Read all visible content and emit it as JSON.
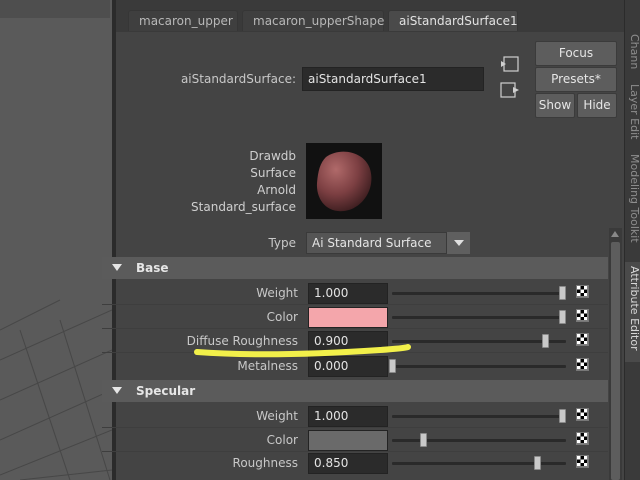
{
  "tabs": [
    {
      "label": "macaron_upper"
    },
    {
      "label": "macaron_upperShape"
    },
    {
      "label": "aiStandardSurface1"
    }
  ],
  "node": {
    "label": "aiStandardSurface:",
    "value": "aiStandardSurface1"
  },
  "buttons": {
    "focus": "Focus",
    "presets": "Presets*",
    "show": "Show",
    "hide": "Hide"
  },
  "swatch_labels": [
    "Drawdb",
    "Surface",
    "Arnold",
    "Standard_surface"
  ],
  "type": {
    "label": "Type",
    "value": "Ai Standard Surface"
  },
  "sections": {
    "base": {
      "title": "Base",
      "rows": [
        {
          "label": "Weight",
          "value": "1.000",
          "slider": 1.0
        },
        {
          "label": "Color",
          "value": "",
          "color": "#f4a6ab",
          "slider": 1.0
        },
        {
          "label": "Diffuse Roughness",
          "value": "0.900",
          "slider": 0.9
        },
        {
          "label": "Metalness",
          "value": "0.000",
          "slider": 0.0
        }
      ]
    },
    "specular": {
      "title": "Specular",
      "rows": [
        {
          "label": "Weight",
          "value": "1.000",
          "slider": 1.0
        },
        {
          "label": "Color",
          "value": "",
          "color": "#6a6a6a",
          "slider": 0.18
        },
        {
          "label": "Roughness",
          "value": "0.850",
          "slider": 0.85
        }
      ]
    }
  },
  "right_tabs": [
    "Chann",
    "Layer Edit",
    "Modeling Toolkit",
    "Attribute Editor"
  ],
  "colors": {
    "highlight": "#f2f04a",
    "section_bg": "#5b5b5b",
    "panel_bg": "#444444"
  }
}
